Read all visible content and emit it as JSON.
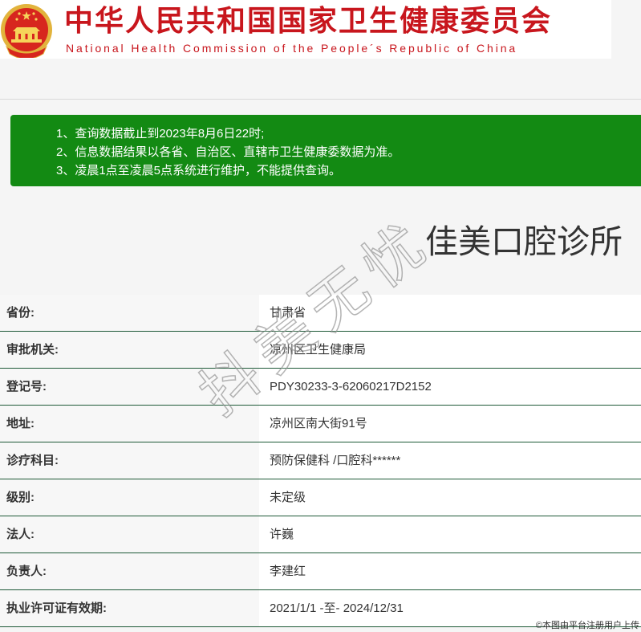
{
  "header": {
    "title_cn": "中华人民共和国国家卫生健康委员会",
    "title_en": "National Health Commission of the People´s Republic of China",
    "emblem_icon": "national-emblem-icon"
  },
  "notice": {
    "lines": [
      "1、查询数据截止到2023年8月6日22时;",
      "2、信息数据结果以各省、自治区、直辖市卫生健康委数据为准。",
      "3、凌晨1点至凌晨5点系统进行维护，不能提供查询。"
    ]
  },
  "institution": {
    "name": "佳美口腔诊所"
  },
  "details": [
    {
      "label": "省份:",
      "value": "甘肃省"
    },
    {
      "label": "审批机关:",
      "value": "凉州区卫生健康局"
    },
    {
      "label": "登记号:",
      "value": "PDY30233-3-62060217D2152"
    },
    {
      "label": "地址:",
      "value": "凉州区南大街91号"
    },
    {
      "label": "诊疗科目:",
      "value": "预防保健科 /口腔科******"
    },
    {
      "label": "级别:",
      "value": "未定级"
    },
    {
      "label": "法人:",
      "value": "许巍"
    },
    {
      "label": "负责人:",
      "value": "李建红"
    },
    {
      "label": "执业许可证有效期:",
      "value": "2021/1/1 -至- 2024/12/31"
    }
  ],
  "watermark": "抖美无忧",
  "copyright": "©本图由平台注册用户上传",
  "colors": {
    "brand_red": "#c8161d",
    "notice_green": "#138a13",
    "row_divider": "#1f5a38"
  }
}
